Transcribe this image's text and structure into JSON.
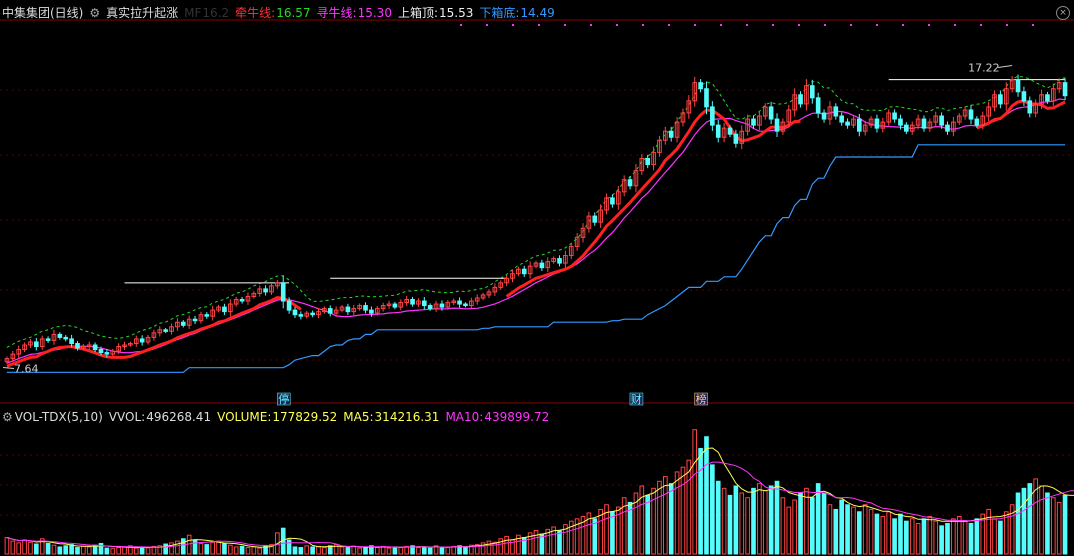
{
  "header": {
    "stock_name": "中集集团(日线)",
    "indicator_name": "真实拉升起涨",
    "ma_label": "MF",
    "ma_value": "16.2",
    "line1_label": "牵牛线:",
    "line1_value": "16.57",
    "line2_label": "寻牛线:",
    "line2_value": "15.30",
    "line3_label": "上箱顶:",
    "line3_value": "15.53",
    "line4_label": "下箱底:",
    "line4_value": "14.49"
  },
  "volume_header": {
    "name": "VOL-TDX(5,10)",
    "vvol_label": "VVOL:",
    "vvol_value": "496268.41",
    "volume_label": "VOLUME:",
    "volume_value": "177829.52",
    "ma5_label": "MA5:",
    "ma5_value": "314216.31",
    "ma10_label": "MA10:",
    "ma10_value": "439899.72"
  },
  "markers": [
    {
      "text": "停",
      "index": 47,
      "color": "#5ff"
    },
    {
      "text": "财",
      "index": 107,
      "color": "#5ff"
    },
    {
      "text": "榜",
      "index": 118,
      "color": "#fc8"
    }
  ],
  "chart_data": {
    "type": "candlestick",
    "price_range": [
      6.8,
      19.0
    ],
    "high_annotation": "17.22",
    "low_annotation": "7.64",
    "colors": {
      "up": "#ff4444",
      "down": "#54fcfc",
      "bull": "#ff2020",
      "seek": "#ff33ff",
      "box_top": "#ffffff",
      "box_bottom": "#3399ff",
      "dashed": "#22dd22",
      "ma5": "#ffff55",
      "ma10": "#ff33ff"
    },
    "volume_max": 1100000,
    "close": [
      7.9,
      8.05,
      8.2,
      8.35,
      8.45,
      8.3,
      8.55,
      8.5,
      8.7,
      8.6,
      8.55,
      8.4,
      8.25,
      8.3,
      8.35,
      8.2,
      8.1,
      8.05,
      8.15,
      8.3,
      8.35,
      8.4,
      8.55,
      8.45,
      8.6,
      8.75,
      8.85,
      8.8,
      8.95,
      9.1,
      9.0,
      9.2,
      9.15,
      9.35,
      9.3,
      9.5,
      9.6,
      9.45,
      9.7,
      9.85,
      9.8,
      9.95,
      10.05,
      10.2,
      10.1,
      10.3,
      10.4,
      9.8,
      9.5,
      9.35,
      9.3,
      9.4,
      9.35,
      9.45,
      9.55,
      9.4,
      9.5,
      9.6,
      9.45,
      9.55,
      9.65,
      9.5,
      9.4,
      9.55,
      9.65,
      9.7,
      9.6,
      9.75,
      9.85,
      9.7,
      9.8,
      9.65,
      9.55,
      9.7,
      9.6,
      9.75,
      9.8,
      9.7,
      9.65,
      9.8,
      9.9,
      10.0,
      10.1,
      10.25,
      10.4,
      10.55,
      10.7,
      10.85,
      10.7,
      10.95,
      11.05,
      10.9,
      11.1,
      11.2,
      11.05,
      11.3,
      11.6,
      11.9,
      12.2,
      12.6,
      12.4,
      12.8,
      13.2,
      13.0,
      13.4,
      13.8,
      13.6,
      14.1,
      14.5,
      14.3,
      14.7,
      15.1,
      15.4,
      15.2,
      15.7,
      16.0,
      16.4,
      17.0,
      16.8,
      16.2,
      15.6,
      15.2,
      15.5,
      15.3,
      15.0,
      15.4,
      15.8,
      15.6,
      15.9,
      16.2,
      15.8,
      15.4,
      15.7,
      16.1,
      16.6,
      16.3,
      16.9,
      16.5,
      16.0,
      15.8,
      16.2,
      15.9,
      15.7,
      15.6,
      15.8,
      15.4,
      15.6,
      15.8,
      15.5,
      15.7,
      16.0,
      15.8,
      15.6,
      15.4,
      15.6,
      15.8,
      15.5,
      15.7,
      15.9,
      15.6,
      15.4,
      15.7,
      15.9,
      16.1,
      15.8,
      15.6,
      15.9,
      16.2,
      16.6,
      16.3,
      16.8,
      17.1,
      16.7,
      16.4,
      16.0,
      16.3,
      16.6,
      16.4,
      16.8,
      17.0,
      16.57
    ],
    "volume": [
      140000,
      110000,
      95000,
      120000,
      100000,
      85000,
      130000,
      90000,
      75000,
      60000,
      70000,
      80000,
      55000,
      65000,
      60000,
      75000,
      90000,
      50000,
      45000,
      55000,
      60000,
      70000,
      50000,
      48000,
      52000,
      65000,
      70000,
      85000,
      95000,
      110000,
      130000,
      160000,
      120000,
      90000,
      80000,
      100000,
      110000,
      90000,
      75000,
      60000,
      65000,
      55000,
      60000,
      50000,
      70000,
      80000,
      180000,
      220000,
      120000,
      60000,
      55000,
      70000,
      60000,
      65000,
      55000,
      70000,
      80000,
      60000,
      55000,
      65000,
      50000,
      60000,
      70000,
      55000,
      65000,
      50000,
      60000,
      55000,
      65000,
      70000,
      55000,
      60000,
      50000,
      70000,
      60000,
      55000,
      65000,
      70000,
      60000,
      75000,
      80000,
      95000,
      110000,
      100000,
      130000,
      150000,
      120000,
      160000,
      140000,
      180000,
      200000,
      170000,
      210000,
      230000,
      200000,
      250000,
      280000,
      300000,
      320000,
      350000,
      300000,
      380000,
      420000,
      360000,
      400000,
      480000,
      440000,
      520000,
      580000,
      500000,
      560000,
      620000,
      660000,
      600000,
      700000,
      740000,
      800000,
      1060000,
      900000,
      1000000,
      760000,
      620000,
      560000,
      500000,
      580000,
      520000,
      480000,
      560000,
      600000,
      540000,
      580000,
      620000,
      480000,
      400000,
      460000,
      520000,
      560000,
      480000,
      600000,
      520000,
      420000,
      380000,
      460000,
      420000,
      400000,
      360000,
      420000,
      380000,
      340000,
      320000,
      360000,
      300000,
      340000,
      280000,
      300000,
      260000,
      300000,
      320000,
      280000,
      240000,
      260000,
      300000,
      320000,
      280000,
      260000,
      300000,
      340000,
      380000,
      300000,
      280000,
      360000,
      420000,
      520000,
      560000,
      600000,
      640000,
      580000,
      520000,
      480000,
      440000,
      500000,
      560000,
      520000,
      560000,
      560000
    ],
    "bull_line": [
      null,
      null,
      null,
      null,
      null,
      null,
      null,
      null,
      null,
      null,
      null,
      null,
      null,
      null,
      null,
      null,
      null,
      null,
      null,
      null,
      null,
      null,
      null,
      null,
      null,
      null,
      null,
      null,
      null,
      null,
      null,
      null,
      null,
      null,
      null,
      null,
      null,
      null,
      null,
      null,
      null,
      null,
      null,
      null,
      null,
      null,
      null,
      null,
      null,
      null,
      null,
      null,
      null,
      null,
      null,
      null,
      null,
      null,
      null,
      null,
      null,
      null,
      null,
      null,
      null,
      null,
      null,
      null,
      null,
      null,
      null,
      null,
      null,
      null,
      null,
      null,
      null,
      null,
      null,
      null,
      null,
      null,
      null,
      null,
      null,
      null,
      null,
      null,
      null,
      null,
      null,
      null,
      null,
      null,
      null,
      null,
      null,
      null,
      null,
      null,
      null,
      null,
      null,
      null,
      null,
      null,
      null,
      null,
      null,
      null,
      null,
      null,
      null,
      null,
      null,
      null,
      null,
      null,
      null,
      null,
      null,
      null,
      null,
      null,
      null,
      null,
      null,
      null,
      null,
      null,
      null,
      null,
      null,
      null,
      null,
      null,
      null,
      null,
      null,
      null,
      null,
      null,
      null,
      null,
      null,
      null,
      null,
      null,
      null,
      null,
      null,
      null,
      null,
      null,
      null,
      null,
      null,
      null,
      null,
      null,
      null,
      null,
      null,
      null,
      null,
      null,
      null,
      null,
      null,
      null,
      null,
      null,
      null,
      null,
      null,
      null,
      null,
      null,
      null,
      null,
      null,
      null,
      null,
      null,
      null,
      null,
      null,
      null,
      null,
      null,
      16.57
    ]
  }
}
